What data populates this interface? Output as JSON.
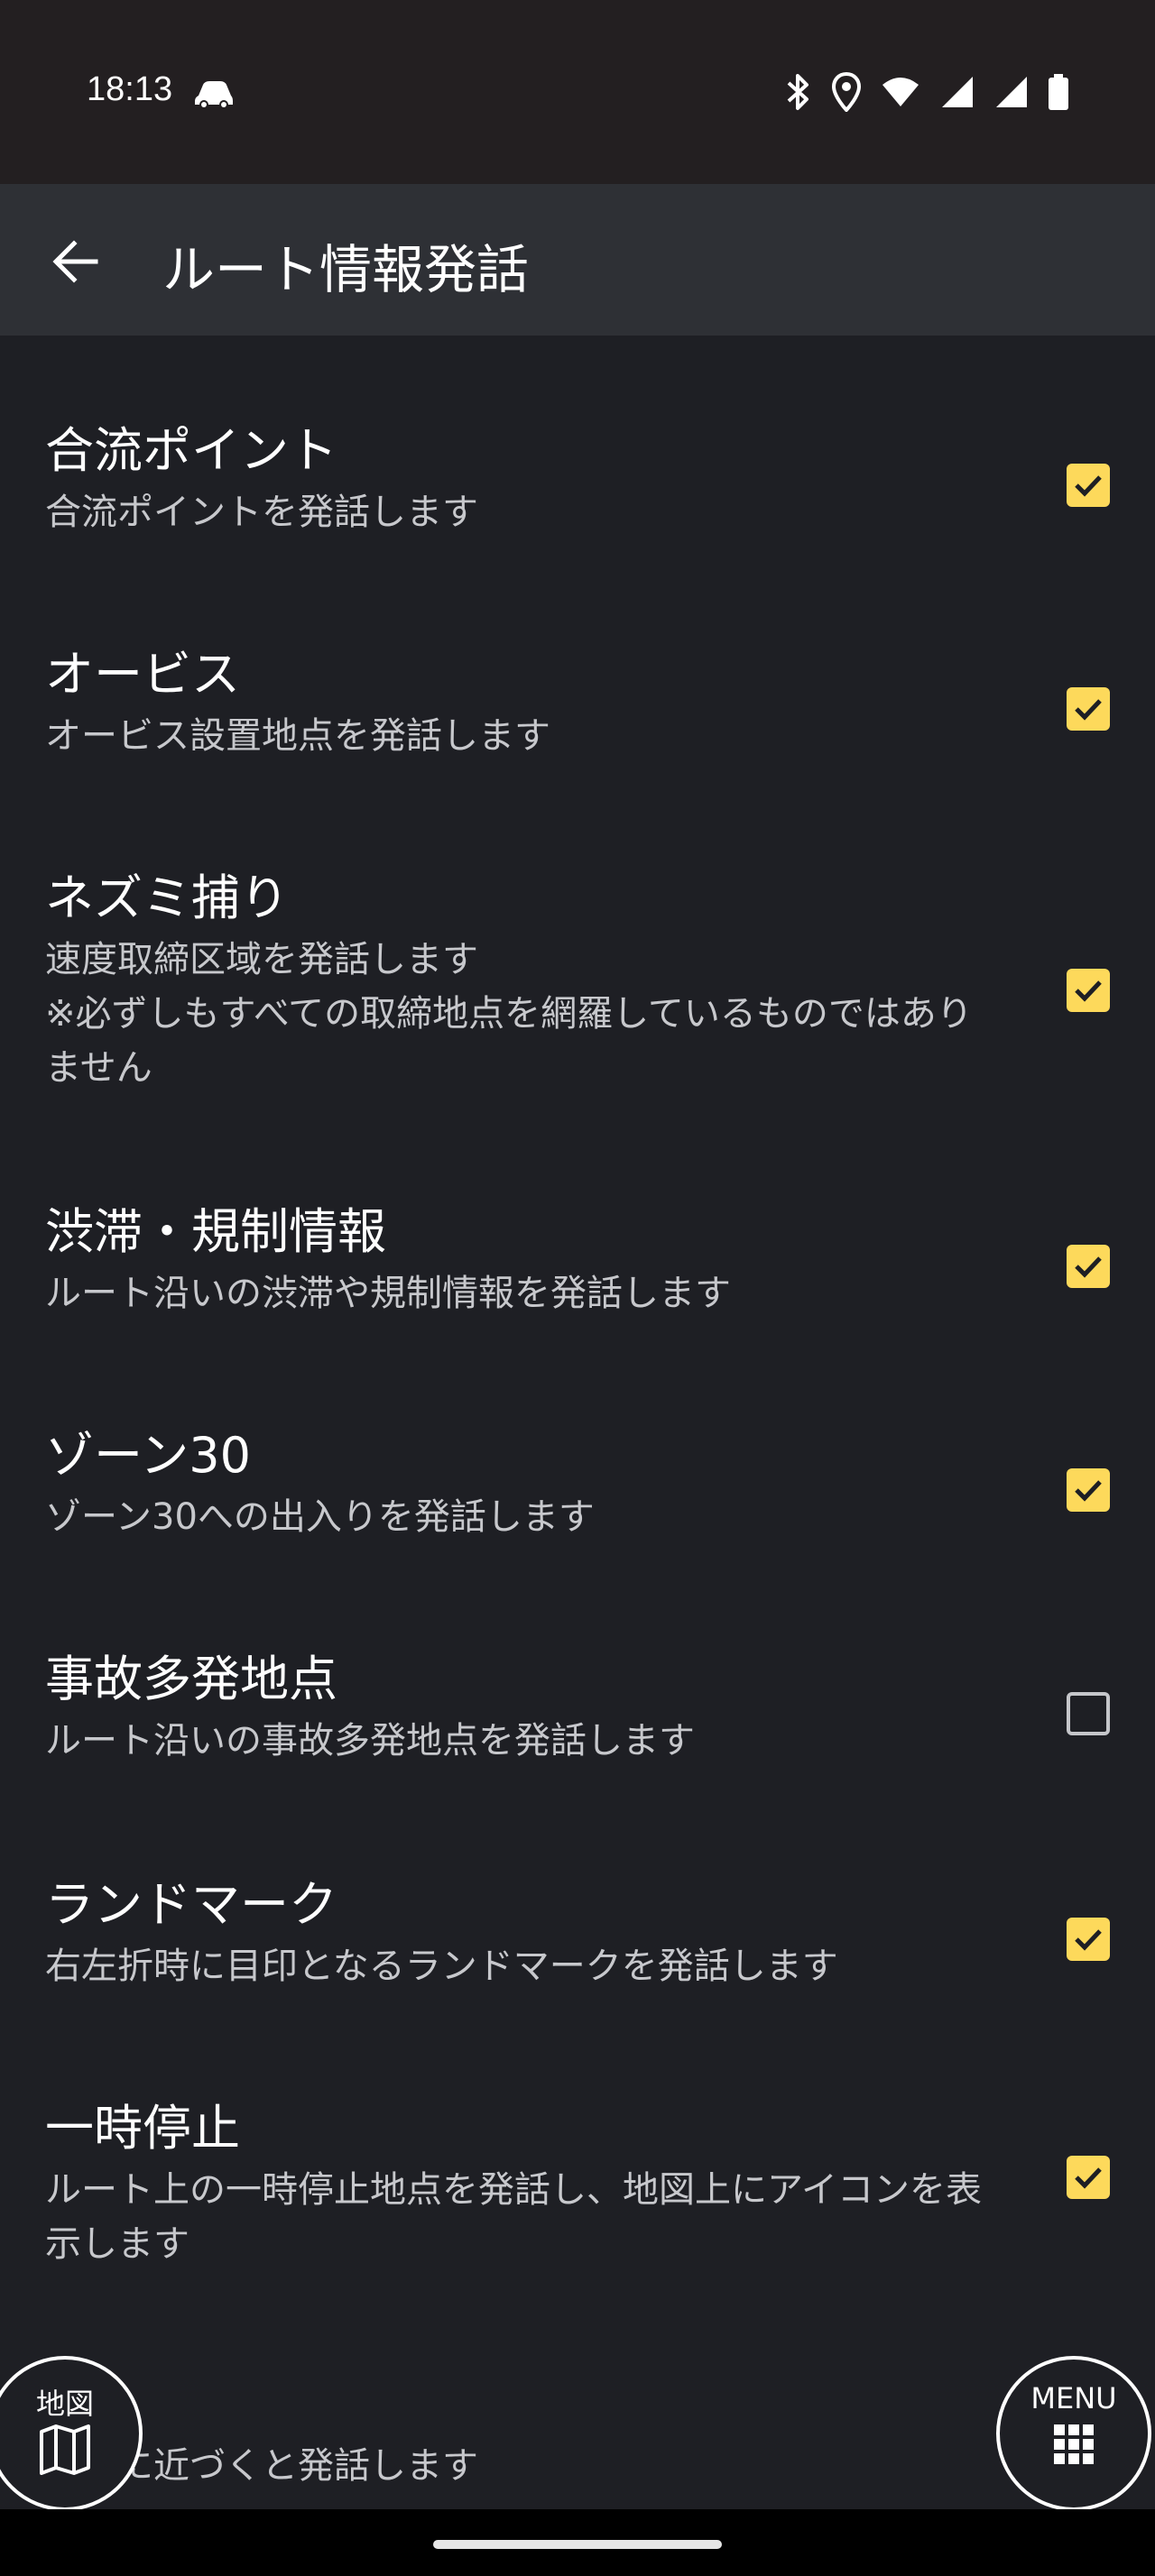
{
  "status_bar": {
    "time": "18:13",
    "icons": [
      "car-icon",
      "bluetooth-icon",
      "location-icon",
      "wifi-icon",
      "signal-icon",
      "signal-icon",
      "battery-icon"
    ]
  },
  "app_bar": {
    "back_icon": "arrow-left-icon",
    "title": "ルート情報発話"
  },
  "colors": {
    "background": "#1e1f24",
    "app_bar": "#2e3035",
    "checkbox_checked": "#fdd95b",
    "subtitle_text": "#c7c8cc"
  },
  "settings": [
    {
      "title": "合流ポイント",
      "subtitle": "合流ポイントを発話します",
      "checked": true
    },
    {
      "title": "オービス",
      "subtitle": "オービス設置地点を発話します",
      "checked": true
    },
    {
      "title": "ネズミ捕り",
      "subtitle": "速度取締区域を発話します\n※必ずしもすべての取締地点を網羅しているものではありません",
      "checked": true
    },
    {
      "title": "渋滞・規制情報",
      "subtitle": "ルート沿いの渋滞や規制情報を発話します",
      "checked": true
    },
    {
      "title": "ゾーン30",
      "subtitle": "ゾーン30への出入りを発話します",
      "checked": true
    },
    {
      "title": "事故多発地点",
      "subtitle": "ルート沿いの事故多発地点を発話します",
      "checked": false
    },
    {
      "title": "ランドマーク",
      "subtitle": "右左折時に目印となるランドマークを発話します",
      "checked": true
    },
    {
      "title": "一時停止",
      "subtitle": "ルート上の一時停止地点を発話し、地図上にアイコンを表示します",
      "checked": true
    },
    {
      "title": "",
      "subtitle": "に近づくと発話します",
      "checked": null
    }
  ],
  "fab_map": {
    "label": "地図",
    "icon": "map-icon"
  },
  "fab_menu": {
    "label": "MENU",
    "icon": "grid-icon"
  }
}
